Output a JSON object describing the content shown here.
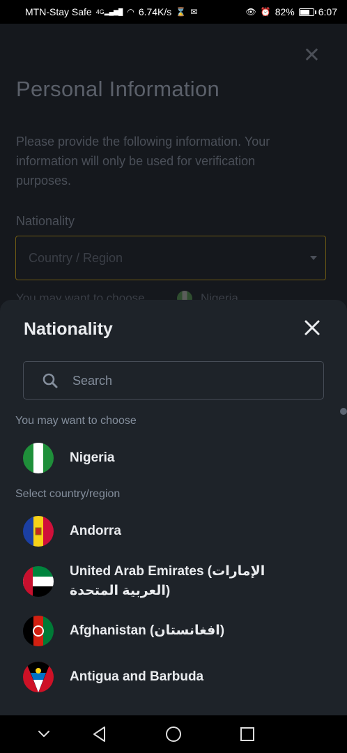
{
  "status_bar": {
    "carrier": "MTN-Stay Safe",
    "network": "4G",
    "speed": "6.74K/s",
    "battery": "82%",
    "battery_level": 0.82,
    "time": "6:07"
  },
  "background_page": {
    "title": "Personal Information",
    "description": "Please provide the following information. Your information will only be used for verification purposes.",
    "nationality_label": "Nationality",
    "select_placeholder": "Country / Region",
    "hint_text": "You may want to choose",
    "hint_country": "Nigeria"
  },
  "sheet": {
    "title": "Nationality",
    "search_placeholder": "Search",
    "suggested_label": "You may want to choose",
    "suggested": [
      {
        "name": "Nigeria",
        "flag": "nigeria-flag"
      }
    ],
    "all_label": "Select country/region",
    "countries": [
      {
        "name": "Andorra",
        "flag": "andorra-flag"
      },
      {
        "name": "United Arab Emirates (الإمارات العربية المتحدة)",
        "flag": "uae-flag"
      },
      {
        "name": "Afghanistan (افغانستان)",
        "flag": "afghanistan-flag"
      },
      {
        "name": "Antigua and Barbuda",
        "flag": "antigua-flag"
      }
    ]
  },
  "colors": {
    "sheet_bg": "#1e2329",
    "text_primary": "#eaecef",
    "text_secondary": "#848e9c",
    "accent_border": "#6e5a14"
  }
}
